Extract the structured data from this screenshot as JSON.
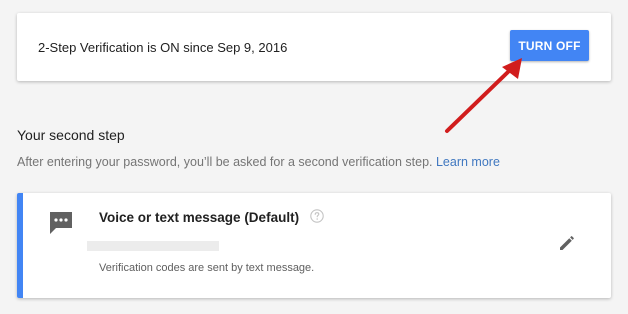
{
  "status": {
    "text": "2-Step Verification is ON since Sep 9, 2016",
    "turn_off_label": "TURN OFF"
  },
  "second_step": {
    "title": "Your second step",
    "description": "After entering your password, you’ll be asked for a second verification step.",
    "learn_more_label": "Learn more"
  },
  "method": {
    "icon": "sms-message-icon",
    "title": "Voice or text message (Default)",
    "help_icon": "help-circle-icon",
    "note": "Verification codes are sent by text message.",
    "edit_icon": "pencil-icon"
  },
  "colors": {
    "accent": "#4285f4",
    "annotation_arrow": "#d11d1d",
    "link": "#4078c0"
  }
}
